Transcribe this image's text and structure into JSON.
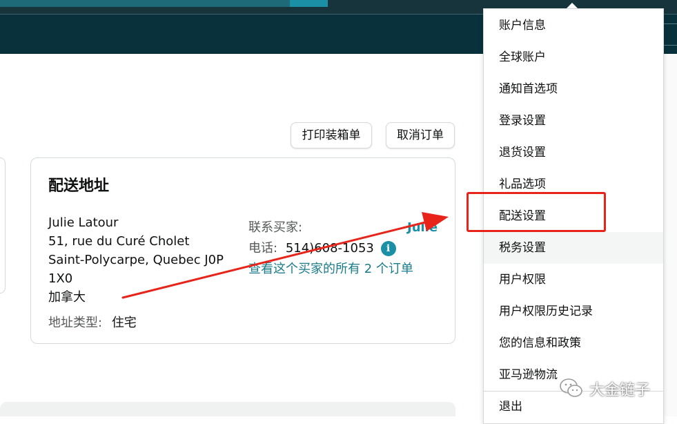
{
  "toolbar": {
    "print_label": "打印装箱单",
    "cancel_label": "取消订单"
  },
  "address": {
    "title": "配送地址",
    "name": "Julie Latour",
    "line1": "51, rue du Curé Cholet",
    "line2": "Saint-Polycarpe, Quebec J0P",
    "line3": "1X0",
    "country": "加拿大",
    "type_label": "地址类型:",
    "type_value": "住宅"
  },
  "contact": {
    "label": "联系买家:",
    "buyer_name": "Julie",
    "phone_label": "电话:",
    "phone_value": "514)608-1053",
    "orders_link": "查看这个买家的所有 2 个订单"
  },
  "menu": {
    "items": [
      {
        "label": "账户信息"
      },
      {
        "label": "全球账户"
      },
      {
        "label": "通知首选项"
      },
      {
        "label": "登录设置"
      },
      {
        "label": "退货设置"
      },
      {
        "label": "礼品选项"
      },
      {
        "label": "配送设置"
      },
      {
        "label": "税务设置"
      },
      {
        "label": "用户权限"
      },
      {
        "label": "用户权限历史记录"
      },
      {
        "label": "您的信息和政策"
      },
      {
        "label": "亚马逊物流"
      },
      {
        "label": "退出"
      }
    ]
  },
  "watermark": {
    "text": "大金链子",
    "icon": "wechat-icon"
  },
  "colors": {
    "annotation": "#e8231a",
    "nav": "#08313b",
    "link": "#1a7b8c"
  }
}
